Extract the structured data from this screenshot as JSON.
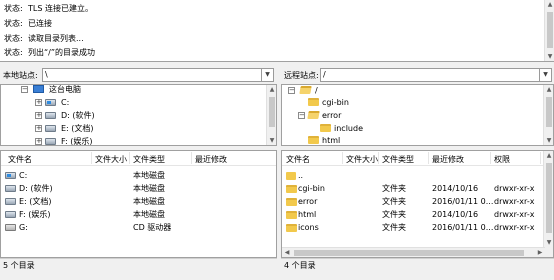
{
  "log": {
    "lines": [
      {
        "label": "状态:",
        "text": "TLS 连接已建立。"
      },
      {
        "label": "状态:",
        "text": "已连接"
      },
      {
        "label": "状态:",
        "text": "读取目录列表..."
      },
      {
        "label": "状态:",
        "text": "列出“/”的目录成功"
      }
    ]
  },
  "local": {
    "site_label": "本地站点:",
    "path": "\\",
    "tree": {
      "root": "这台电脑",
      "drives": [
        "C:",
        "D: (软件)",
        "E: (文档)",
        "F: (娱乐)"
      ]
    },
    "columns": [
      "文件名",
      "文件大小",
      "文件类型",
      "最近修改"
    ],
    "rows": [
      {
        "name": "C:",
        "size": "",
        "type": "本地磁盘",
        "modified": ""
      },
      {
        "name": "D: (软件)",
        "size": "",
        "type": "本地磁盘",
        "modified": ""
      },
      {
        "name": "E: (文档)",
        "size": "",
        "type": "本地磁盘",
        "modified": ""
      },
      {
        "name": "F: (娱乐)",
        "size": "",
        "type": "本地磁盘",
        "modified": ""
      },
      {
        "name": "G:",
        "size": "",
        "type": "CD 驱动器",
        "modified": ""
      }
    ],
    "status": "5 个目录"
  },
  "remote": {
    "site_label": "远程站点:",
    "path": "/",
    "tree": {
      "root": "/",
      "items": [
        "cgi-bin",
        "error",
        "include",
        "html"
      ]
    },
    "columns": [
      "文件名",
      "文件大小",
      "文件类型",
      "最近修改",
      "权限",
      "所"
    ],
    "rows": [
      {
        "name": "..",
        "size": "",
        "type": "",
        "modified": "",
        "perms": ""
      },
      {
        "name": "cgi-bin",
        "size": "",
        "type": "文件夹",
        "modified": "2014/10/16",
        "perms": "drwxr-xr-x"
      },
      {
        "name": "error",
        "size": "",
        "type": "文件夹",
        "modified": "2016/01/11 0...",
        "perms": "drwxr-xr-x"
      },
      {
        "name": "html",
        "size": "",
        "type": "文件夹",
        "modified": "2014/10/16",
        "perms": "drwxr-xr-x"
      },
      {
        "name": "icons",
        "size": "",
        "type": "文件夹",
        "modified": "2016/01/11 0...",
        "perms": "drwxr-xr-x"
      }
    ],
    "status": "4 个目录"
  }
}
